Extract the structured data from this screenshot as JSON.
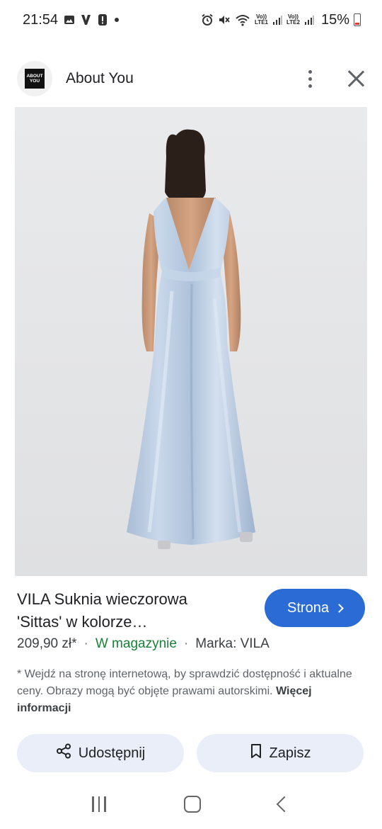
{
  "status_bar": {
    "time": "21:54",
    "battery": "15%",
    "lte1": "LTE1",
    "lte2": "LTE2",
    "volte": "Vo))"
  },
  "header": {
    "site_name": "About You",
    "logo_line1": "ABOUT",
    "logo_line2": "YOU"
  },
  "product": {
    "title_line1": "VILA Suknia wieczorowa",
    "title_line2": "'Sittas' w kolorze…",
    "price": "209,90 zł*",
    "availability": "W magazynie",
    "brand": "Marka: VILA",
    "separator": "·"
  },
  "visit_button": {
    "label": "Strona"
  },
  "disclaimer": {
    "text": "* Wejdź na stronę internetową, by sprawdzić dostępność i aktualne ceny. Obrazy mogą być objęte prawami autorskimi.",
    "more_link": "Więcej informacji"
  },
  "actions": {
    "share_label": "Udostępnij",
    "save_label": "Zapisz"
  },
  "colors": {
    "accent": "#2a6bd6",
    "in_stock": "#188038",
    "action_bg": "#e9eef9",
    "image_bg": "#e6e7e9"
  }
}
